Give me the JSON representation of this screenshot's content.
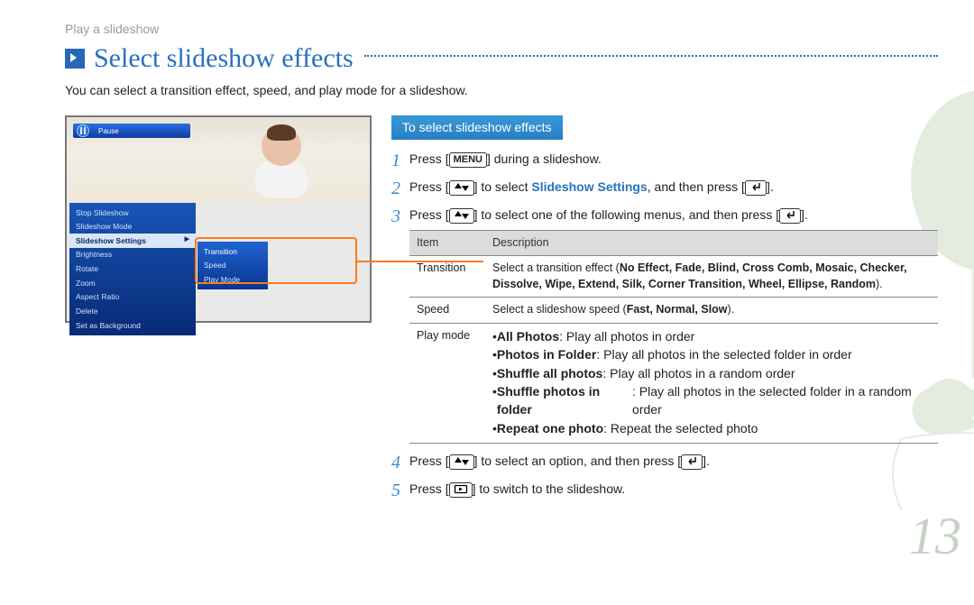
{
  "breadcrumb": "Play a slideshow",
  "heading": "Select slideshow effects",
  "intro": "You can select a transition effect, speed, and play mode for a slideshow.",
  "screenshot": {
    "pause_label": "Pause",
    "menu": [
      "Stop Slideshow",
      "Slideshow Mode",
      "Slideshow Settings",
      "Brightness",
      "Rotate",
      "Zoom",
      "Aspect Ratio",
      "Delete",
      "Set as Background"
    ],
    "menu_selected_index": 2,
    "submenu": [
      "Transition",
      "Speed",
      "Play Mode"
    ]
  },
  "subheading": "To select slideshow effects",
  "steps": {
    "s1_pre": "Press ",
    "s1_key": "MENU",
    "s1_post": " during a slideshow.",
    "s2_pre": "Press ",
    "s2_mid": " to select ",
    "s2_link": "Slideshow Settings",
    "s2_post": ", and then press ",
    "s2_end": ".",
    "s3_pre": "Press ",
    "s3_mid": " to select one of the following menus, and then press ",
    "s3_end": ".",
    "s4_pre": "Press ",
    "s4_mid": " to select an option, and then press ",
    "s4_end": ".",
    "s5_pre": "Press ",
    "s5_post": " to switch to the slideshow."
  },
  "table": {
    "h1": "Item",
    "h2": "Description",
    "transition": {
      "label": "Transition",
      "text_pre": "Select a transition effect (",
      "opts": "No Effect, Fade, Blind, Cross Comb, Mosaic, Checker, Dissolve, Wipe, Extend, Silk, Corner Transition, Wheel, Ellipse, Random",
      "text_post": ")."
    },
    "speed": {
      "label": "Speed",
      "text_pre": "Select a slideshow speed (",
      "opts": "Fast, Normal, Slow",
      "text_post": ")."
    },
    "playmode": {
      "label": "Play mode",
      "b1a": "All Photos",
      "b1b": ": Play all photos in order",
      "b2a": "Photos in Folder",
      "b2b": ": Play all photos in the selected folder in order",
      "b3a": "Shuffle all photos",
      "b3b": ": Play all photos in a random order",
      "b4a": "Shuffle photos in folder",
      "b4b": ": Play all photos in the selected folder in a random order",
      "b5a": "Repeat one photo",
      "b5b": ": Repeat the selected photo"
    }
  },
  "page_number": "13"
}
